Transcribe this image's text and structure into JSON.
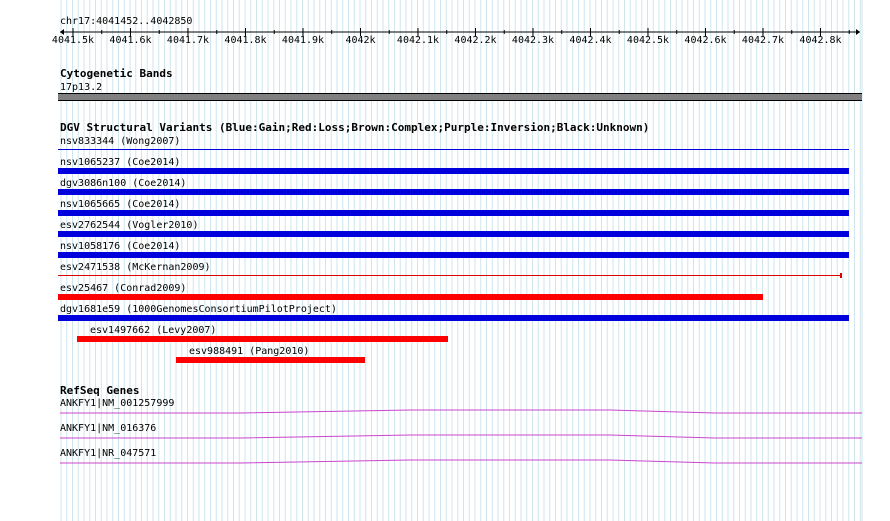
{
  "ruler": {
    "range": "chr17:4041452..4042850",
    "ticks": [
      "4041.5k",
      "4041.6k",
      "4041.7k",
      "4041.8k",
      "4041.9k",
      "4042k",
      "4042.1k",
      "4042.2k",
      "4042.3k",
      "4042.4k",
      "4042.5k",
      "4042.6k",
      "4042.7k",
      "4042.8k"
    ]
  },
  "cytobands": {
    "title": "Cytogenetic Bands",
    "band": "17p13.2"
  },
  "dgv": {
    "title": "DGV Structural Variants (Blue:Gain;Red:Loss;Brown:Complex;Purple:Inversion;Black:Unknown)",
    "features": [
      {
        "label": "nsv833344 (Wong2007)",
        "type": "gain",
        "color": "#0000dd",
        "start": 4041452,
        "end": 4042850,
        "thin": true
      },
      {
        "label": "nsv1065237 (Coe2014)",
        "type": "gain",
        "color": "#0000dd",
        "start": 4041452,
        "end": 4042850
      },
      {
        "label": "dgv3086n100 (Coe2014)",
        "type": "gain",
        "color": "#0000dd",
        "start": 4041452,
        "end": 4042850
      },
      {
        "label": "nsv1065665 (Coe2014)",
        "type": "gain",
        "color": "#0000dd",
        "start": 4041452,
        "end": 4042850
      },
      {
        "label": "esv2762544 (Vogler2010)",
        "type": "gain",
        "color": "#0000dd",
        "start": 4041452,
        "end": 4042850
      },
      {
        "label": "nsv1058176 (Coe2014)",
        "type": "gain",
        "color": "#0000dd",
        "start": 4041452,
        "end": 4042850
      },
      {
        "label": "esv2471538 (McKernan2009)",
        "type": "loss",
        "color": "#dd0000",
        "start": 4041452,
        "end": 4042835,
        "thin": true
      },
      {
        "label": "esv25467 (Conrad2009)",
        "type": "loss",
        "color": "#ff0000",
        "start": 4041452,
        "end": 4042700
      },
      {
        "label": "dgv1681e59 (1000GenomesConsortiumPilotProject)",
        "type": "gain",
        "color": "#0000dd",
        "start": 4041452,
        "end": 4042850
      },
      {
        "label": "esv1497662 (Levy2007)",
        "type": "loss",
        "color": "#ff0000",
        "start": 4041507,
        "end": 4042152
      },
      {
        "label": "esv988491 (Pang2010)",
        "type": "loss",
        "color": "#ff0000",
        "start": 4041679,
        "end": 4042007
      }
    ]
  },
  "refseq": {
    "title": "RefSeq Genes",
    "genes": [
      {
        "label": "ANKFY1|NM_001257999",
        "color": "#cc44cc"
      },
      {
        "label": "ANKFY1|NM_016376",
        "color": "#cc44cc"
      },
      {
        "label": "ANKFY1|NR_047571",
        "color": "#cc44cc"
      }
    ]
  }
}
